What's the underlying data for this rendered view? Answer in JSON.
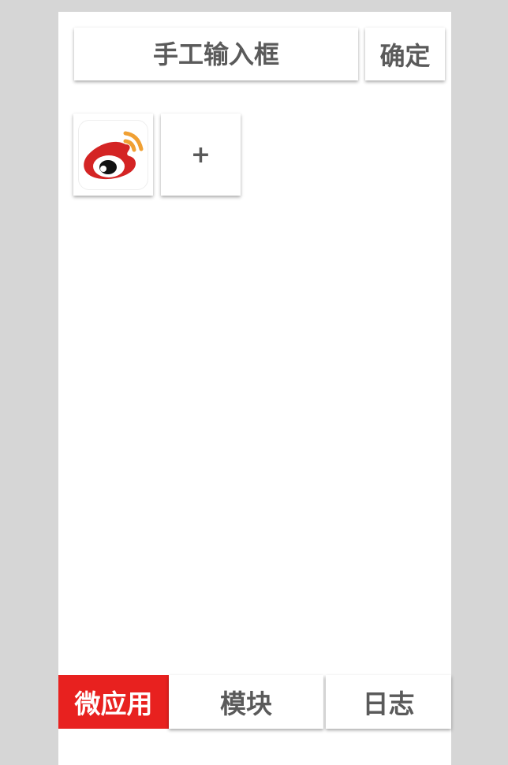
{
  "header": {
    "input_placeholder": "手工输入框",
    "confirm_label": "确定"
  },
  "tiles": [
    {
      "icon": "weibo-logo-icon"
    },
    {
      "label": "+"
    }
  ],
  "tabs": [
    {
      "label": "微应用",
      "active": true
    },
    {
      "label": "模块",
      "active": false
    },
    {
      "label": "日志",
      "active": false
    }
  ],
  "colors": {
    "accent": "#e8211f",
    "text": "#5a5a5a",
    "background": "#d6d6d6",
    "panel": "#ffffff"
  }
}
